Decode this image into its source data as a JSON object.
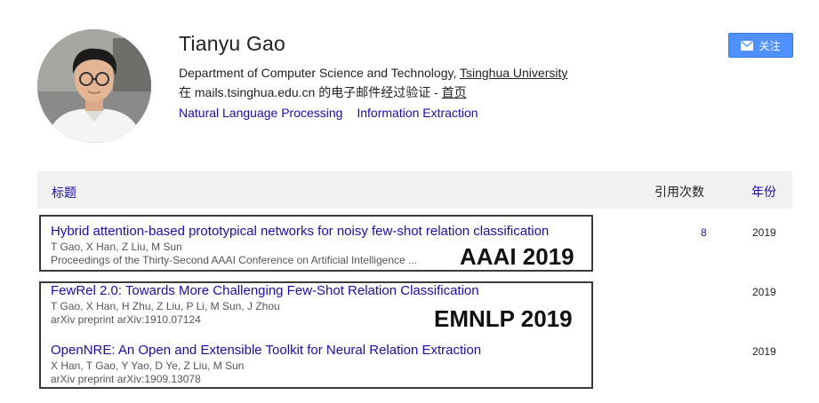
{
  "profile": {
    "name": "Tianyu Gao",
    "department": "Department of Computer Science and Technology, ",
    "university": "Tsinghua University",
    "email_verified": "在 mails.tsinghua.edu.cn 的电子邮件经过验证 - ",
    "homepage_label": "首页",
    "interests": [
      "Natural Language Processing",
      "Information Extraction"
    ],
    "follow_label": "关注",
    "follow_icon": "envelope-icon",
    "avatar_icon": "avatar-photo"
  },
  "table": {
    "header": {
      "title": "标题",
      "cited_by": "引用次数",
      "year": "年份"
    },
    "papers": [
      {
        "title": "Hybrid attention-based prototypical networks for noisy few-shot relation classification",
        "authors": "T Gao, X Han, Z Liu, M Sun",
        "venue": "Proceedings of the Thirty-Second AAAI Conference on Artificial Intelligence ...",
        "cited_by": "8",
        "year": "2019"
      },
      {
        "title": "FewRel 2.0: Towards More Challenging Few-Shot Relation Classification",
        "authors": "T Gao, X Han, H Zhu, Z Liu, P Li, M Sun, J Zhou",
        "venue": "arXiv preprint arXiv:1910.07124",
        "cited_by": "",
        "year": "2019"
      },
      {
        "title": "OpenNRE: An Open and Extensible Toolkit for Neural Relation Extraction",
        "authors": "X Han, T Gao, Y Yao, D Ye, Z Liu, M Sun",
        "venue": "arXiv preprint arXiv:1909.13078",
        "cited_by": "",
        "year": "2019"
      }
    ]
  },
  "annotations": {
    "box1_label": "AAAI 2019",
    "box2_label": "EMNLP 2019"
  },
  "colors": {
    "link": "#1a0dab",
    "button": "#4d90fe",
    "header_bg": "#f1f1f1",
    "annotation_border": "#3a3a3a"
  }
}
